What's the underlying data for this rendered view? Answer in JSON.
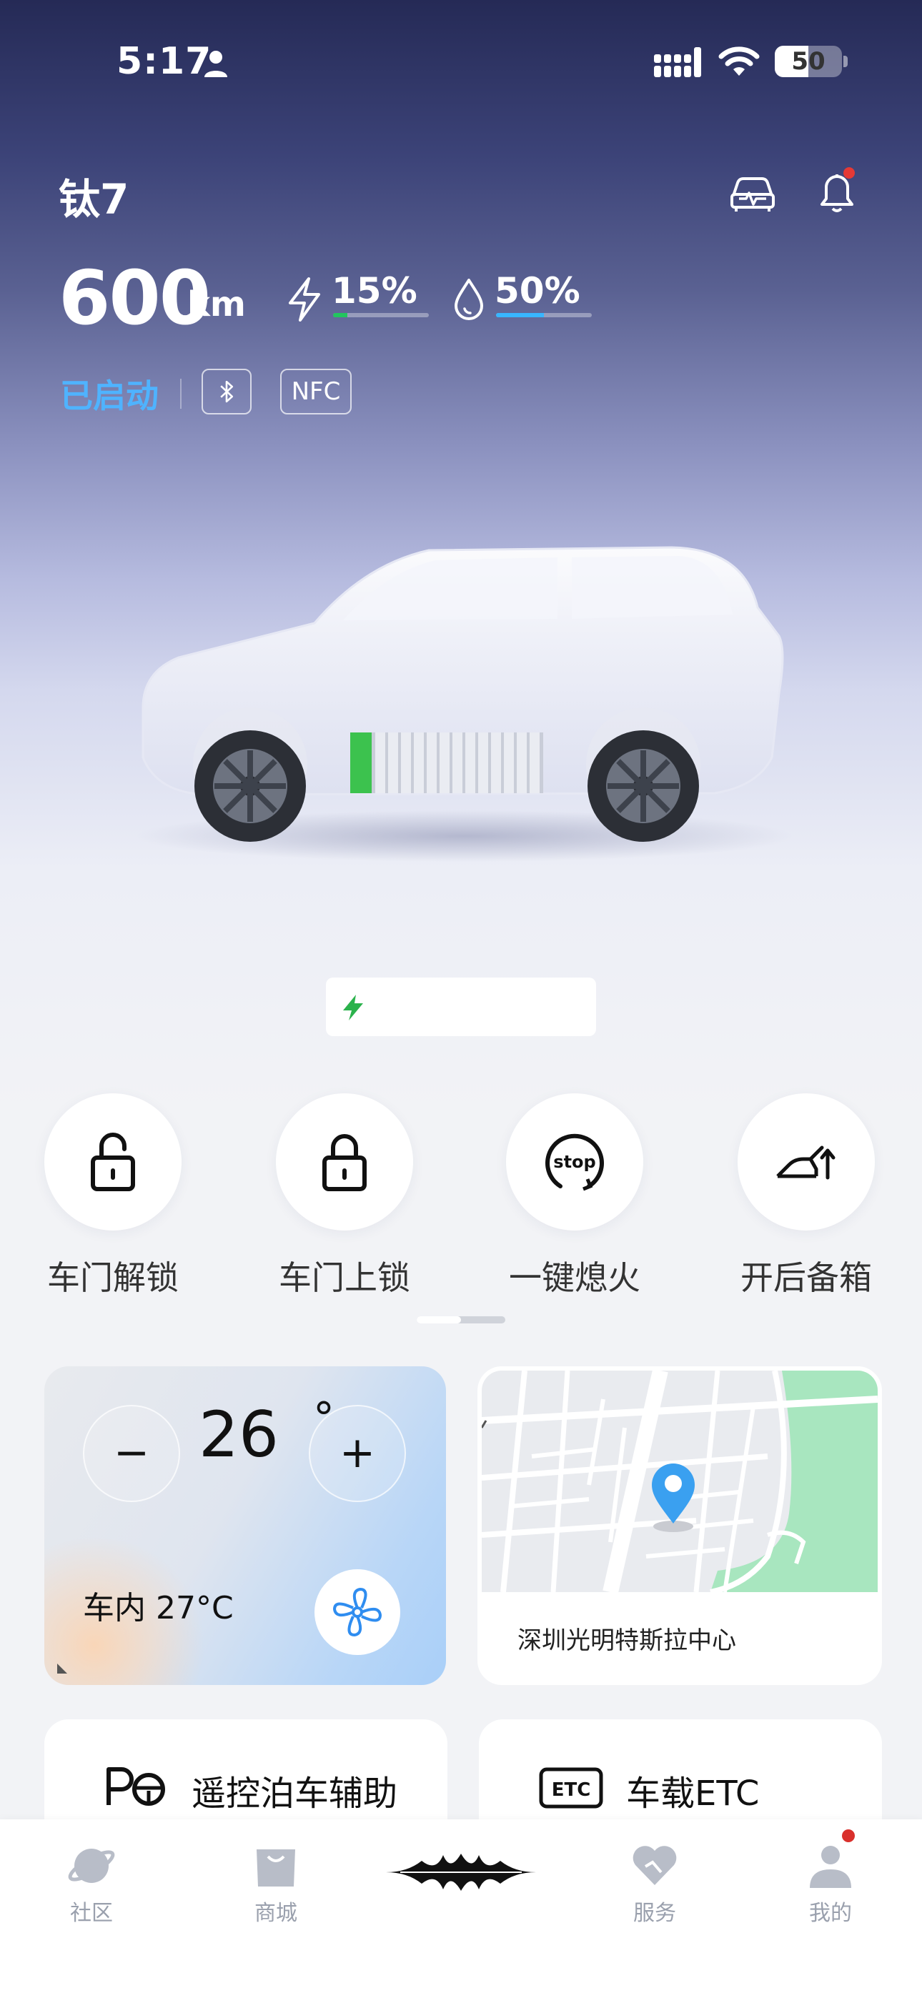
{
  "status_bar": {
    "time": "5:17",
    "battery": "50",
    "battery_level": 0.5,
    "icons": [
      "person-icon",
      "signal-icon",
      "wifi-icon",
      "battery-icon"
    ]
  },
  "header": {
    "car_name": "钛7",
    "icons": [
      "car-diagnostics-icon",
      "bell-icon"
    ],
    "has_notification": true
  },
  "stats": {
    "range_value": "600",
    "range_unit": "km",
    "electric": {
      "percent_label": "15%",
      "level": 0.15,
      "color": "#22c55e",
      "icon": "bolt-icon"
    },
    "fuel": {
      "percent_label": "50%",
      "level": 0.5,
      "color": "#38b6ff",
      "icon": "droplet-icon"
    }
  },
  "status_row": {
    "status_text": "已启动",
    "status_color": "#4fb3ff",
    "bluetooth_icon": "bluetooth-icon",
    "nfc_label": "NFC"
  },
  "charge_pill": {
    "icon": "charge-bolt-icon",
    "text": ""
  },
  "quick_actions": [
    {
      "label": "车门解锁",
      "icon": "unlock-icon"
    },
    {
      "label": "车门上锁",
      "icon": "lock-icon"
    },
    {
      "label": "一键熄火",
      "icon": "stop-engine-icon",
      "icon_text": "stop"
    },
    {
      "label": "开后备箱",
      "icon": "trunk-icon"
    }
  ],
  "climate": {
    "minus": "−",
    "plus": "+",
    "temperature": "26",
    "degree": "°",
    "inside_label": "车内 27°C"
  },
  "map": {
    "location": "深圳光明特斯拉中心",
    "colors": {
      "land": "#e9ebef",
      "park": "#a8e6bf",
      "pin": "#3aa0f0"
    }
  },
  "features": [
    {
      "label": "遥控泊车辅助",
      "icon": "remote-parking-icon"
    },
    {
      "label": "车载ETC",
      "icon": "etc-icon",
      "icon_text": "ETC"
    }
  ],
  "tabbar": {
    "tabs": [
      {
        "label": "社区",
        "icon": "planet-icon"
      },
      {
        "label": "商城",
        "icon": "shopping-bag-icon"
      },
      {
        "label": "",
        "icon": "brand-logo-icon"
      },
      {
        "label": "服务",
        "icon": "service-heart-icon"
      },
      {
        "label": "我的",
        "icon": "profile-icon",
        "has_badge": true
      }
    ]
  }
}
